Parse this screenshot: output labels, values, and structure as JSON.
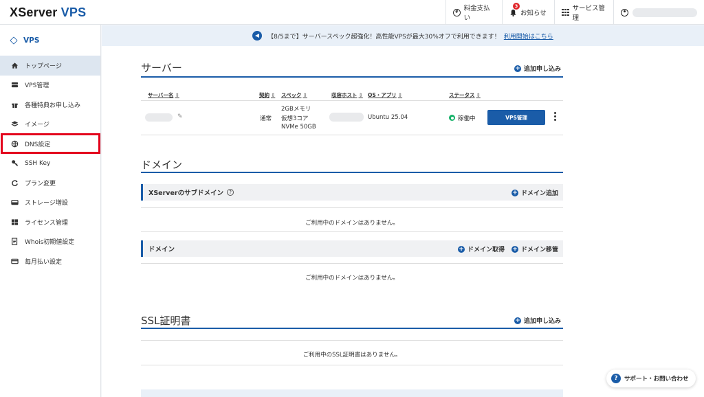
{
  "header": {
    "logo_main": "XServer",
    "logo_accent": "VPS",
    "billing": "料金支払い",
    "billing_icon": "¥",
    "notice": "お知らせ",
    "notice_count": "3",
    "service": "サービス管理"
  },
  "sidebar": {
    "title": "VPS",
    "items": [
      {
        "label": "トップページ",
        "icon": "home-icon"
      },
      {
        "label": "VPS管理",
        "icon": "server-icon"
      },
      {
        "label": "各種特典お申し込み",
        "icon": "gift-icon"
      },
      {
        "label": "イメージ",
        "icon": "layers-icon"
      },
      {
        "label": "DNS設定",
        "icon": "globe-icon"
      },
      {
        "label": "SSH Key",
        "icon": "key-icon"
      },
      {
        "label": "プラン変更",
        "icon": "refresh-icon"
      },
      {
        "label": "ストレージ増設",
        "icon": "storage-icon"
      },
      {
        "label": "ライセンス管理",
        "icon": "windows-icon"
      },
      {
        "label": "Whois初期値設定",
        "icon": "document-icon"
      },
      {
        "label": "毎月払い設定",
        "icon": "card-icon"
      }
    ]
  },
  "banner": {
    "text": "【8/5まで】サーバースペック超強化！高性能VPSが最大30%オフで利用できます！",
    "link": "利用開始はこちら"
  },
  "server": {
    "title": "サーバー",
    "add": "追加申し込み",
    "columns": [
      "サーバー名",
      "契約",
      "スペック",
      "収容ホスト",
      "OS・アプリ",
      "ステータス"
    ],
    "row": {
      "contract": "通常",
      "spec_mem": "2GBメモリ",
      "spec_cpu": "仮想3コア",
      "spec_disk": "NVMe 50GB",
      "os": "Ubuntu 25.04",
      "status": "稼働中",
      "manage_button": "VPS管理"
    }
  },
  "domain": {
    "title": "ドメイン",
    "xserver_sub": "XServerのサブドメイン",
    "xserver_add": "ドメイン追加",
    "xserver_empty": "ご利用中のドメインはありません。",
    "domain_head": "ドメイン",
    "acquire": "ドメイン取得",
    "transfer": "ドメイン移管",
    "domain_empty": "ご利用中のドメインはありません。"
  },
  "ssl": {
    "title": "SSL証明書",
    "add": "追加申し込み",
    "empty": "ご利用中のSSL証明書はありません。"
  },
  "support": {
    "label": "サポート・お問い合わせ"
  },
  "colors": {
    "accent": "#1a5ca8",
    "highlight": "#e3001b",
    "status_running": "#17b26a"
  }
}
